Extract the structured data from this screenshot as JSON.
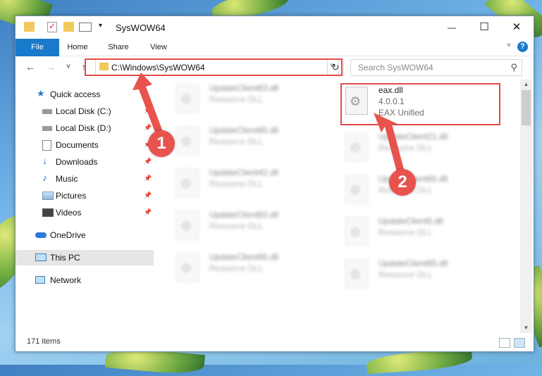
{
  "window": {
    "title": "SysWOW64",
    "minimize": "—",
    "maximize": "☐",
    "close": "✕"
  },
  "ribbon": {
    "tabs": [
      "File",
      "Home",
      "Share",
      "View"
    ],
    "help": "?"
  },
  "nav": {
    "back": "←",
    "forward": "→",
    "recent": "˅",
    "up": "↑",
    "address": "C:\\Windows\\SysWOW64",
    "refresh": "↻",
    "search_placeholder": "Search SysWOW64"
  },
  "sidebar": {
    "items": [
      {
        "label": "Quick access",
        "icon": "star-icon"
      },
      {
        "label": "Local Disk (C:)",
        "icon": "drive-icon"
      },
      {
        "label": "Local Disk (D:)",
        "icon": "drive-icon"
      },
      {
        "label": "Documents",
        "icon": "documents-icon"
      },
      {
        "label": "Downloads",
        "icon": "download-icon"
      },
      {
        "label": "Music",
        "icon": "music-icon"
      },
      {
        "label": "Pictures",
        "icon": "pictures-icon"
      },
      {
        "label": "Videos",
        "icon": "videos-icon"
      },
      {
        "label": "OneDrive",
        "icon": "cloud-icon"
      },
      {
        "label": "This PC",
        "icon": "computer-icon"
      },
      {
        "label": "Network",
        "icon": "network-icon"
      }
    ]
  },
  "files": {
    "left": [
      {
        "name": "UpdateClient63.dll",
        "type": "Resource DLL"
      },
      {
        "name": "UpdateClient65.dll",
        "type": "Resource DLL"
      },
      {
        "name": "UpdateClient42.dll",
        "type": "Resource DLL"
      },
      {
        "name": "UpdateClient63.dll",
        "type": "Resource DLL"
      },
      {
        "name": "UpdateClient65.dll",
        "type": "Resource DLL"
      }
    ],
    "highlighted": {
      "name": "eax.dll",
      "version": "4.0.0.1",
      "description": "EAX Unified"
    },
    "right": [
      {
        "name": "UpdateClient21.dll",
        "type": "Resource DLL"
      },
      {
        "name": "UpdateClient65.dll",
        "type": "Resource DLL"
      },
      {
        "name": "UpdateClient5.dll",
        "type": "Resource DLL"
      },
      {
        "name": "UpdateClient65.dll",
        "type": "Resource DLL"
      }
    ]
  },
  "status": {
    "count": "171 items"
  },
  "annotations": {
    "step1": "1",
    "step2": "2",
    "color": "#e8534e"
  }
}
